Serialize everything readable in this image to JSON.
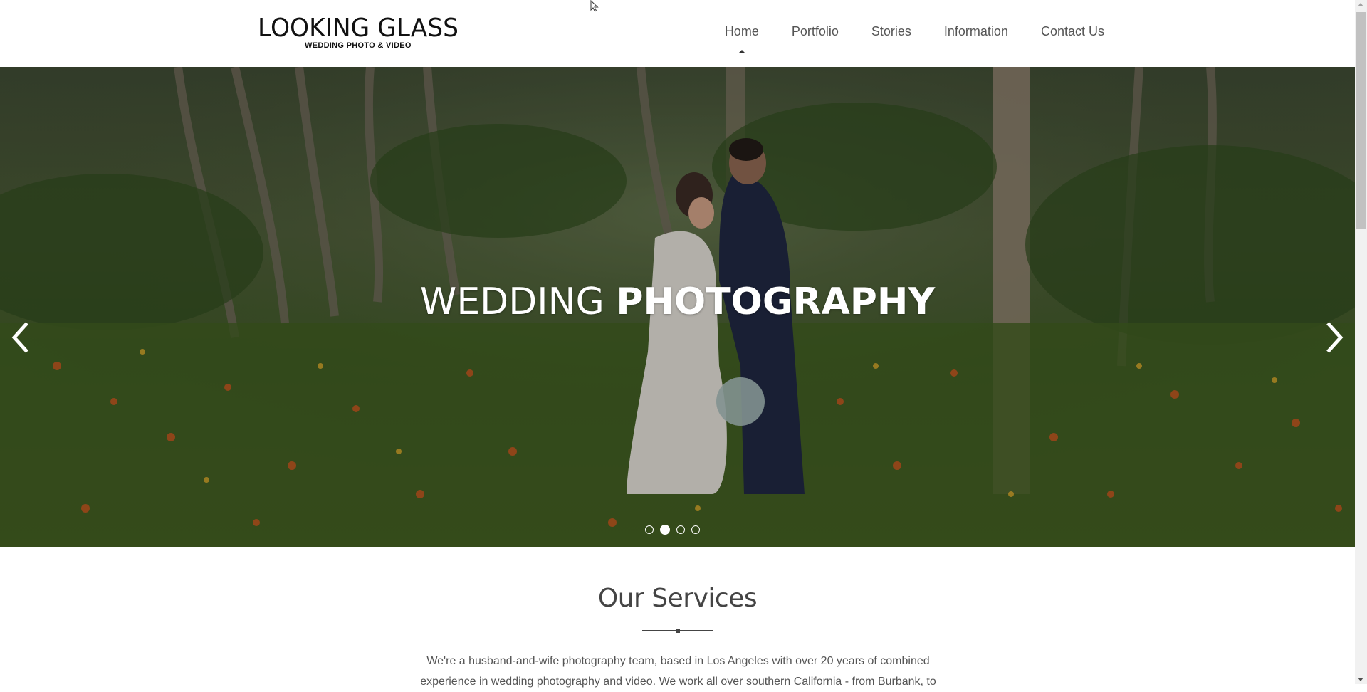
{
  "header": {
    "logo": {
      "brand": "LOOKING GLASS",
      "tagline": "WEDDING PHOTO & VIDEO"
    },
    "nav": [
      {
        "label": "Home",
        "active": true
      },
      {
        "label": "Portfolio"
      },
      {
        "label": "Stories"
      },
      {
        "label": "Information"
      },
      {
        "label": "Contact Us"
      }
    ]
  },
  "hero": {
    "title_light": "WEDDING ",
    "title_bold": "PHOTOGRAPHY",
    "prev_icon": "chevron-left-icon",
    "next_icon": "chevron-right-icon",
    "slides_count": 4,
    "active_slide": 2
  },
  "services": {
    "title": "Our Services",
    "paragraph": "We're a husband-and-wife photography team, based in Los Angeles with over 20 years of combined experience in wedding photography and video. We work all over southern California - from Burbank, to"
  },
  "colors": {
    "text": "#444444",
    "nav_text": "#555555",
    "white": "#ffffff"
  }
}
